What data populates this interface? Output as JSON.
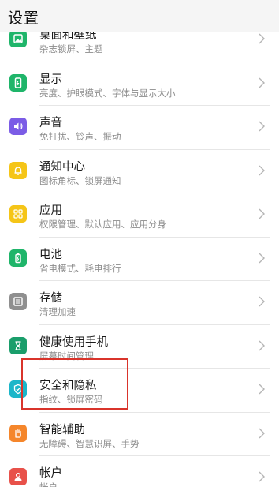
{
  "header": {
    "title": "设置"
  },
  "items": [
    {
      "label": "桌面和壁纸",
      "sub": "杂志锁屏、主题",
      "icon": "image-icon",
      "color": "#1fb56a"
    },
    {
      "label": "显示",
      "sub": "亮度、护眼模式、字体与显示大小",
      "icon": "phone-display-icon",
      "color": "#1fb56a"
    },
    {
      "label": "声音",
      "sub": "免打扰、铃声、振动",
      "icon": "speaker-icon",
      "color": "#7b5ce6"
    },
    {
      "label": "通知中心",
      "sub": "图标角标、锁屏通知",
      "icon": "bell-icon",
      "color": "#f5c518"
    },
    {
      "label": "应用",
      "sub": "权限管理、默认应用、应用分身",
      "icon": "grid-icon",
      "color": "#f5c518"
    },
    {
      "label": "电池",
      "sub": "省电模式、耗电排行",
      "icon": "battery-icon",
      "color": "#1fb56a"
    },
    {
      "label": "存储",
      "sub": "清理加速",
      "icon": "storage-icon",
      "color": "#8f8f8f"
    },
    {
      "label": "健康使用手机",
      "sub": "屏幕时间管理",
      "icon": "hourglass-icon",
      "color": "#1a9e6b"
    },
    {
      "label": "安全和隐私",
      "sub": "指纹、锁屏密码",
      "icon": "shield-icon",
      "color": "#1cb6c9"
    },
    {
      "label": "智能辅助",
      "sub": "无障碍、智慧识屏、手势",
      "icon": "hand-icon",
      "color": "#f5862b"
    },
    {
      "label": "帐户",
      "sub": "帐户",
      "icon": "account-icon",
      "color": "#e8514a"
    }
  ]
}
